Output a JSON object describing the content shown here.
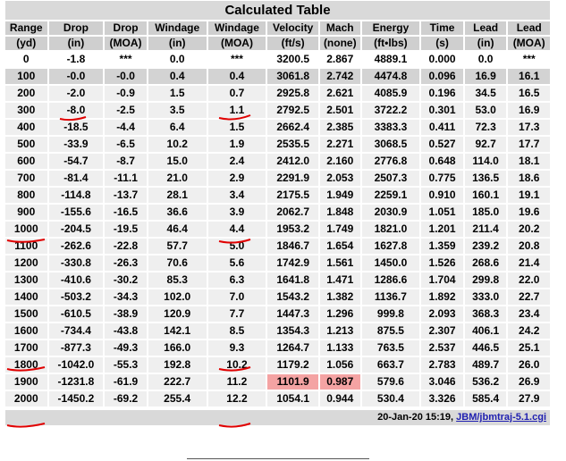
{
  "table": {
    "caption": "Calculated Table",
    "headers": [
      [
        "Range",
        "(yd)"
      ],
      [
        "Drop",
        "(in)"
      ],
      [
        "Drop",
        "(MOA)"
      ],
      [
        "Windage",
        "(in)"
      ],
      [
        "Windage",
        "(MOA)"
      ],
      [
        "Velocity",
        "(ft/s)"
      ],
      [
        "Mach",
        "(none)"
      ],
      [
        "Energy",
        "(ft•lbs)"
      ],
      [
        "Time",
        "(s)"
      ],
      [
        "Lead",
        "(in)"
      ],
      [
        "Lead",
        "(MOA)"
      ]
    ],
    "rows": [
      [
        "0",
        "-1.8",
        "***",
        "0.0",
        "***",
        "3200.5",
        "2.867",
        "4889.1",
        "0.000",
        "0.0",
        "***"
      ],
      [
        "100",
        "-0.0",
        "-0.0",
        "0.4",
        "0.4",
        "3061.8",
        "2.742",
        "4474.8",
        "0.096",
        "16.9",
        "16.1"
      ],
      [
        "200",
        "-2.0",
        "-0.9",
        "1.5",
        "0.7",
        "2925.8",
        "2.621",
        "4085.9",
        "0.196",
        "34.5",
        "16.5"
      ],
      [
        "300",
        "-8.0",
        "-2.5",
        "3.5",
        "1.1",
        "2792.5",
        "2.501",
        "3722.2",
        "0.301",
        "53.0",
        "16.9"
      ],
      [
        "400",
        "-18.5",
        "-4.4",
        "6.4",
        "1.5",
        "2662.4",
        "2.385",
        "3383.3",
        "0.411",
        "72.3",
        "17.3"
      ],
      [
        "500",
        "-33.9",
        "-6.5",
        "10.2",
        "1.9",
        "2535.5",
        "2.271",
        "3068.5",
        "0.527",
        "92.7",
        "17.7"
      ],
      [
        "600",
        "-54.7",
        "-8.7",
        "15.0",
        "2.4",
        "2412.0",
        "2.160",
        "2776.8",
        "0.648",
        "114.0",
        "18.1"
      ],
      [
        "700",
        "-81.4",
        "-11.1",
        "21.0",
        "2.9",
        "2291.9",
        "2.053",
        "2507.3",
        "0.775",
        "136.5",
        "18.6"
      ],
      [
        "800",
        "-114.8",
        "-13.7",
        "28.1",
        "3.4",
        "2175.5",
        "1.949",
        "2259.1",
        "0.910",
        "160.1",
        "19.1"
      ],
      [
        "900",
        "-155.6",
        "-16.5",
        "36.6",
        "3.9",
        "2062.7",
        "1.848",
        "2030.9",
        "1.051",
        "185.0",
        "19.6"
      ],
      [
        "1000",
        "-204.5",
        "-19.5",
        "46.4",
        "4.4",
        "1953.2",
        "1.749",
        "1821.0",
        "1.201",
        "211.4",
        "20.2"
      ],
      [
        "1100",
        "-262.6",
        "-22.8",
        "57.7",
        "5.0",
        "1846.7",
        "1.654",
        "1627.8",
        "1.359",
        "239.2",
        "20.8"
      ],
      [
        "1200",
        "-330.8",
        "-26.3",
        "70.6",
        "5.6",
        "1742.9",
        "1.561",
        "1450.0",
        "1.526",
        "268.6",
        "21.4"
      ],
      [
        "1300",
        "-410.6",
        "-30.2",
        "85.3",
        "6.3",
        "1641.8",
        "1.471",
        "1286.6",
        "1.704",
        "299.8",
        "22.0"
      ],
      [
        "1400",
        "-503.2",
        "-34.3",
        "102.0",
        "7.0",
        "1543.2",
        "1.382",
        "1136.7",
        "1.892",
        "333.0",
        "22.7"
      ],
      [
        "1500",
        "-610.5",
        "-38.9",
        "120.9",
        "7.7",
        "1447.3",
        "1.296",
        "999.8",
        "2.093",
        "368.3",
        "23.4"
      ],
      [
        "1600",
        "-734.4",
        "-43.8",
        "142.1",
        "8.5",
        "1354.3",
        "1.213",
        "875.5",
        "2.307",
        "406.1",
        "24.2"
      ],
      [
        "1700",
        "-877.3",
        "-49.3",
        "166.0",
        "9.3",
        "1264.7",
        "1.133",
        "763.5",
        "2.537",
        "446.5",
        "25.1"
      ],
      [
        "1800",
        "-1042.0",
        "-55.3",
        "192.8",
        "10.2",
        "1179.2",
        "1.056",
        "663.7",
        "2.783",
        "489.7",
        "26.0"
      ],
      [
        "1900",
        "-1231.8",
        "-61.9",
        "222.7",
        "11.2",
        "1101.9",
        "0.987",
        "579.6",
        "3.046",
        "536.2",
        "26.9"
      ],
      [
        "2000",
        "-1450.2",
        "-69.2",
        "255.4",
        "12.2",
        "1054.1",
        "0.944",
        "530.4",
        "3.326",
        "585.4",
        "27.9"
      ]
    ]
  },
  "footer": {
    "date": "20-Jan-20 15:19, ",
    "link": "JBM/jbmtraj-5.1.cgi"
  },
  "colors": {
    "highlight_red": "#f4a3a3",
    "annotation_red": "#e00000"
  }
}
